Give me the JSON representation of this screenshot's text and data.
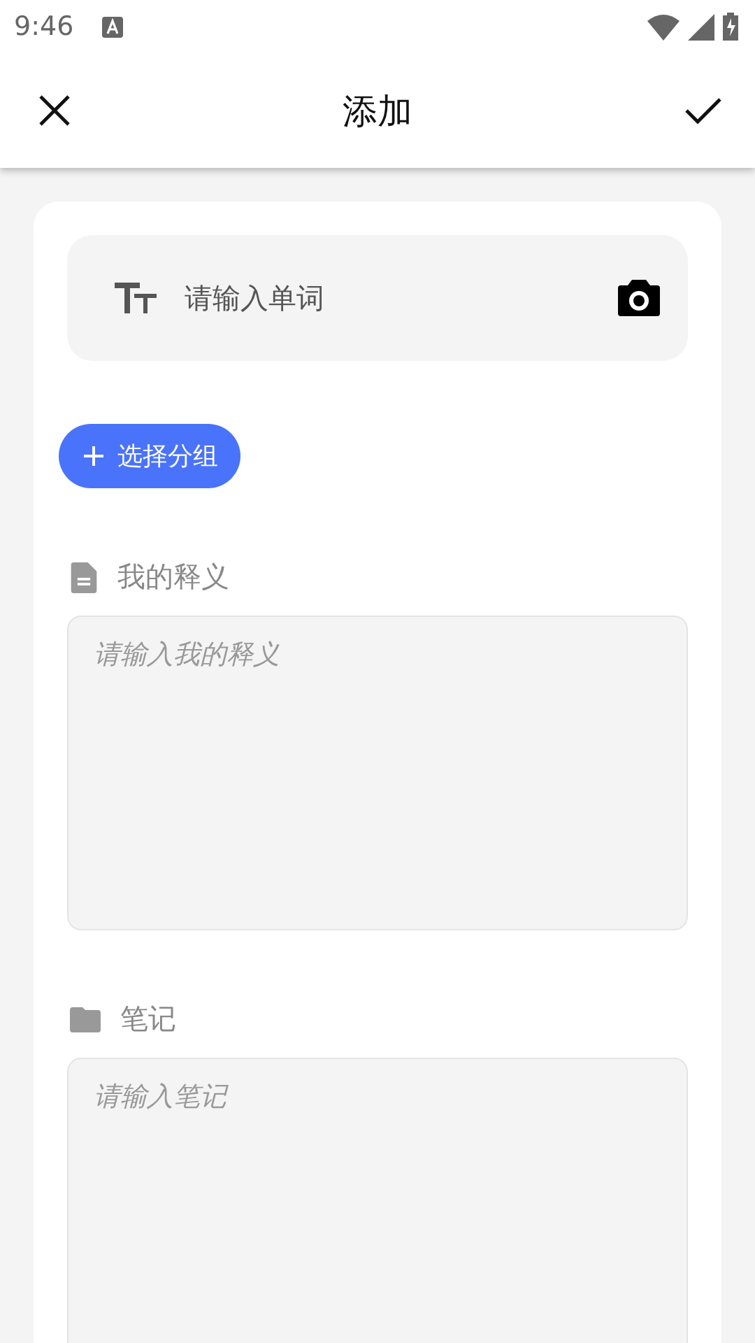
{
  "status_bar": {
    "time": "9:46"
  },
  "app_bar": {
    "title": "添加"
  },
  "word_field": {
    "placeholder": "请输入单词"
  },
  "group_button": {
    "label": "选择分组"
  },
  "sections": [
    {
      "kind": "definition",
      "label": "我的释义",
      "placeholder": "请输入我的释义"
    },
    {
      "kind": "note",
      "label": "笔记",
      "placeholder": "请输入笔记"
    }
  ]
}
